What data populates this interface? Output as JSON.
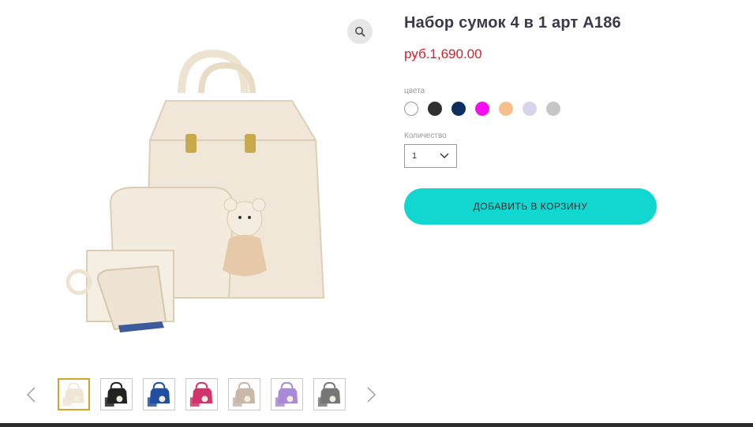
{
  "product": {
    "title": "Набор сумок 4 в 1 арт А186",
    "price": "руб.1,690.00",
    "colors_label": "цвета",
    "colors": [
      "#ffffff",
      "#2f2f2f",
      "#0d2f5e",
      "#f50ff0",
      "#f5c08e",
      "#d9d3ec",
      "#c6c6c6"
    ],
    "quantity_label": "Количество",
    "quantity_value": "1",
    "add_to_cart_label": "ДОБАВИТЬ В КОРЗИНУ"
  },
  "gallery": {
    "thumbnail_colors": [
      "#efe6d6",
      "#222222",
      "#1f4fa0",
      "#d2336c",
      "#c9b7a9",
      "#a98ad6",
      "#777777"
    ],
    "active_index": 0
  },
  "icons": {
    "zoom": "magnifier-icon",
    "prev": "chevron-left-icon",
    "next": "chevron-right-icon",
    "select": "chevron-down-icon"
  }
}
